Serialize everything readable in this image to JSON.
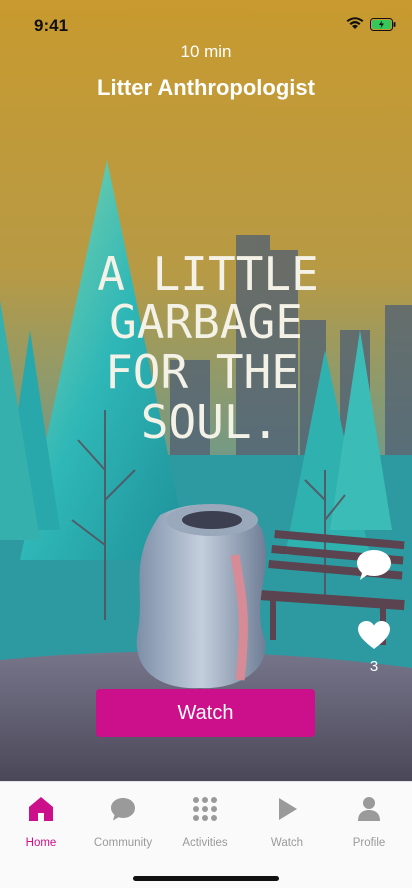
{
  "status_bar": {
    "time": "9:41",
    "battery_color": "#34c759"
  },
  "header": {
    "duration": "10 min",
    "title": "Litter Anthropologist"
  },
  "artwork": {
    "text_lines": [
      "A LITTLE",
      "GARBAGE",
      "FOR THE",
      "SOUL."
    ],
    "sky_color": "#c49a35",
    "tree_color": "#2fb7b7",
    "ground_color": "#5e5a6c"
  },
  "actions": {
    "like_count": "3"
  },
  "watch_button": {
    "label": "Watch",
    "color": "#cc0f8a"
  },
  "tabbar": {
    "active_color": "#cc0f8a",
    "inactive_color": "#9a9a9a",
    "tabs": [
      {
        "label": "Home",
        "icon": "home-icon",
        "active": true
      },
      {
        "label": "Community",
        "icon": "chat-bubble-icon",
        "active": false
      },
      {
        "label": "Activities",
        "icon": "grid-dots-icon",
        "active": false
      },
      {
        "label": "Watch",
        "icon": "play-icon",
        "active": false
      },
      {
        "label": "Profile",
        "icon": "person-icon",
        "active": false
      }
    ]
  }
}
